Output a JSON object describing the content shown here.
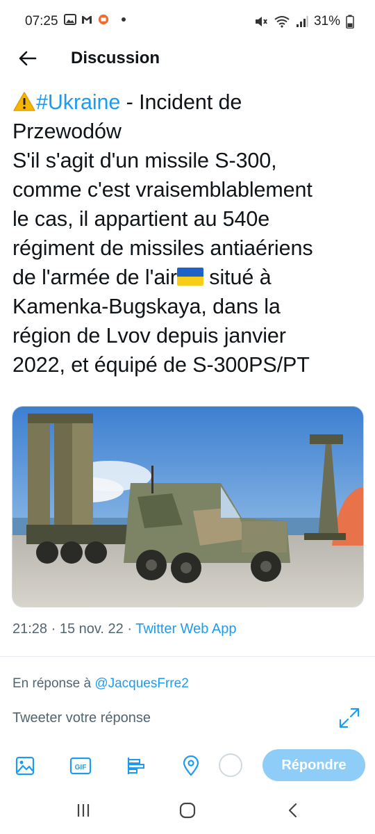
{
  "status_bar": {
    "time": "07:25",
    "battery": "31%",
    "left_icons": [
      "gallery-icon",
      "gmail-icon",
      "app-notification-icon",
      "dot-icon"
    ],
    "right_icons": [
      "mute-icon",
      "wifi-icon",
      "signal-icon",
      "battery-icon"
    ]
  },
  "header": {
    "title": "Discussion"
  },
  "tweet": {
    "hashtag": "#Ukraine",
    "line1_suffix": " - Incident de",
    "line2": "Przewodów",
    "line3": "S'il s'agit d'un missile S-300,",
    "line4": "comme c'est vraisemblablement",
    "line5": "le cas, il appartient au 540e",
    "line6": "régiment de missiles antiaériens",
    "line7_prefix": "de l'armée de l'air",
    "line7_suffix": " situé à",
    "line8": "Kamenka-Bugskaya, dans la",
    "line9": "région de Lvov depuis janvier",
    "line10": "2022, et équipé de S-300PS/PT",
    "emoji_warning": "warning-icon",
    "emoji_flag": "ukraine-flag-icon"
  },
  "meta": {
    "time": "21:28",
    "date": "15 nov. 22",
    "app": "Twitter Web App",
    "separator": " · "
  },
  "reply": {
    "reply_to_label": "En réponse à ",
    "reply_to_handle": "@JacquesFrre2",
    "compose_placeholder": "Tweeter votre réponse",
    "reply_button": "Répondre"
  },
  "colors": {
    "accent": "#1d9bf0",
    "reply_button_disabled": "#8ecdf8",
    "secondary_text": "#536471"
  }
}
